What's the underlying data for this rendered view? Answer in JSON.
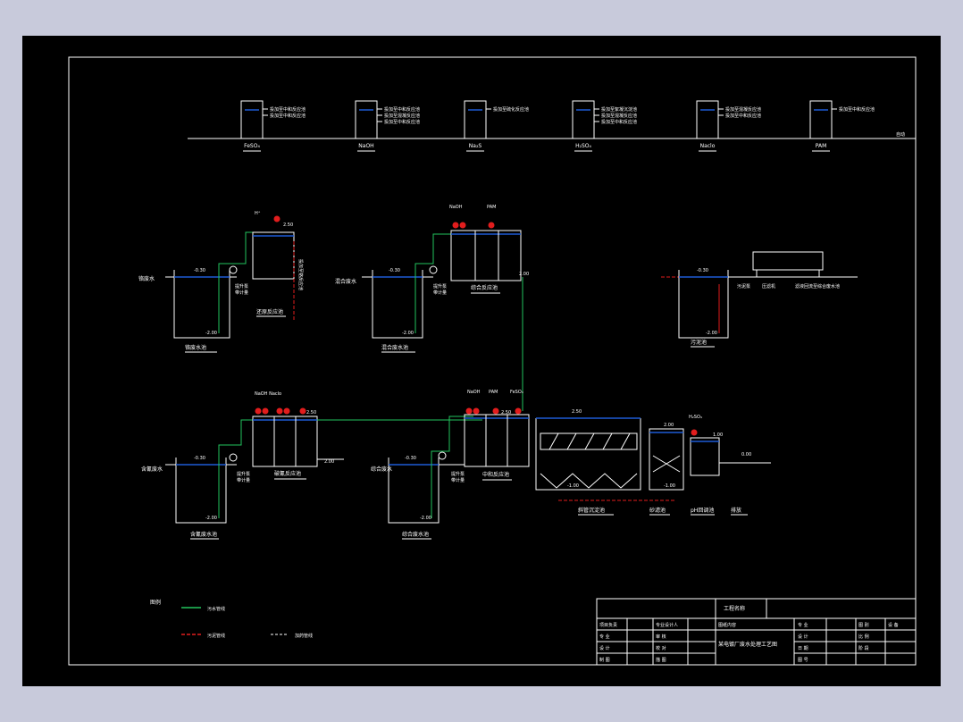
{
  "colors": {
    "background": "#c8cadb",
    "canvas": "#000000",
    "lines": "#ffffff",
    "water_line": "#1e5bd6",
    "water_pipe": "#22c55e",
    "sludge_pipe": "#e11d1d",
    "dosing_pipe": "#ffffff"
  },
  "dosing": {
    "tanks": [
      {
        "label": "FeSO₄",
        "lines": [
          "投加至中和反应池",
          "投加至中和反应池"
        ]
      },
      {
        "label": "NaOH",
        "lines": [
          "投加至中和反应池",
          "投加至混凝反应池",
          "投加至中和反应池"
        ]
      },
      {
        "label": "Na₂S",
        "lines": [
          "投加至硫化反应池"
        ]
      },
      {
        "label": "H₂SO₄",
        "lines": [
          "投加至絮凝沉淀池",
          "投加至混凝反应池",
          "投加至中和反应池"
        ]
      },
      {
        "label": "Naclo",
        "lines": [
          "投加至混凝反应池",
          "投加至中和反应池"
        ]
      },
      {
        "label": "PAM",
        "lines": [
          "投加至中和反应池"
        ]
      }
    ],
    "main_label": "自动"
  },
  "units": {
    "u1": {
      "inlet": "铬废水",
      "pump": "提升泵",
      "pump_sub": "带计量",
      "tank": "铬废水池",
      "reactor": "还原反应池",
      "lv1": "-0.30",
      "lv2": "2.50",
      "lv3": "-2.00",
      "dose": "H⁺",
      "side": "投加至铬反应池"
    },
    "u2": {
      "inlet": "混合废水",
      "pump": "提升泵",
      "pump_sub": "带计量",
      "tank": "混合废水池",
      "reactor": "综合反应池",
      "lv1": "-0.30",
      "lv2": "-2.00",
      "dose1": "NaOH",
      "dose2": "PAM",
      "lv4": "2.00"
    },
    "u3": {
      "tank": "污泥池",
      "label1": "污泥泵",
      "label2": "压滤机",
      "label3": "滤液回流至综合废水池",
      "lv1": "-0.30",
      "lv2": "-2.00"
    },
    "u4": {
      "inlet": "含氰废水",
      "pump": "提升泵",
      "pump_sub": "带计量",
      "tank": "含氰废水池",
      "reactor": "破氰反应池",
      "lv1": "-0.30",
      "lv2": "2.50",
      "lv3": "-2.00",
      "lv4": "2.00",
      "dose": "NaOH Naclo"
    },
    "u5": {
      "inlet": "综合废水",
      "pump": "提升泵",
      "pump_sub": "带计量",
      "tank": "综合废水池",
      "reactor": "中和反应池",
      "lv1": "-0.30",
      "lv2": "2.50",
      "lv3": "-2.00",
      "lv4": "2.50",
      "dose1": "NaOH",
      "dose2": "PAM",
      "dose3": "FeSO₄"
    },
    "u6": {
      "settler": "斜管沉淀池",
      "filter": "砂滤池",
      "ph_tank": "pH回调池",
      "outlet": "排放",
      "lv_top": "2.50",
      "lv_bot": "-1.00",
      "lv_f1": "2.00",
      "lv_f2": "-1.00",
      "lv_ph": "1.00",
      "lv_out": "0.00",
      "dose": "H₂SO₄"
    }
  },
  "legend": {
    "title": "图例",
    "items": [
      {
        "label": "污水管线"
      },
      {
        "label": "污泥管线"
      },
      {
        "label": "加药管线"
      }
    ]
  },
  "title_block": {
    "project_label": "工程名称",
    "project_value": "",
    "rows": [
      [
        "项目负责",
        "",
        "专业设计人",
        ""
      ],
      [
        "专  业",
        "",
        "审  核",
        ""
      ],
      [
        "设  计",
        "",
        "校  对",
        ""
      ],
      [
        "制  图",
        "",
        "描  图",
        ""
      ]
    ],
    "drawing_label": "图纸内容",
    "drawing_title": "某电镀厂废水处理工艺图",
    "meta": [
      [
        "专  业",
        "",
        "图  别",
        "设  备"
      ],
      [
        "设  计",
        "",
        "比  例",
        ""
      ],
      [
        "日  期",
        "",
        "阶  段",
        ""
      ],
      [
        "图  号",
        "",
        "",
        ""
      ]
    ]
  }
}
